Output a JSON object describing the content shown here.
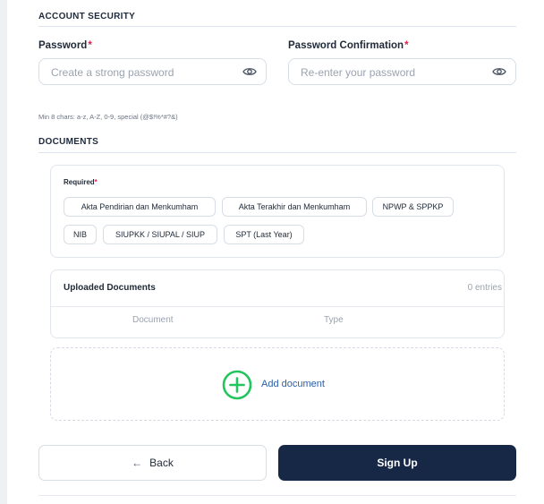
{
  "account_security": {
    "title": "ACCOUNT SECURITY",
    "password": {
      "label": "Password",
      "required_mark": "*",
      "placeholder": "Create a strong password",
      "icon": "eye-icon"
    },
    "password_confirmation": {
      "label": "Password Confirmation",
      "required_mark": "*",
      "placeholder": "Re-enter your password",
      "icon": "eye-icon"
    },
    "hint": "Min 8 chars: a-z, A-Z, 0-9, special (@$!%*#?&)"
  },
  "documents": {
    "title": "DOCUMENTS",
    "required_label": "Required",
    "required_mark": "*",
    "required_docs": [
      "Akta Pendirian dan Menkumham",
      "Akta Terakhir dan Menkumham",
      "NPWP & SPPKP",
      "NIB",
      "SIUPKK / SIUPAL / SIUP",
      "SPT (Last Year)"
    ],
    "uploaded": {
      "title": "Uploaded Documents",
      "entries": "0 entries",
      "columns": [
        "Document",
        "Type"
      ]
    },
    "add_label": "Add document",
    "add_icon": "plus-circle-icon"
  },
  "actions": {
    "back_arrow": "←",
    "back_label": "Back",
    "signup_label": "Sign Up"
  },
  "colors": {
    "primary": "#172746",
    "required": "#e11d48",
    "add_icon": "#22c55e",
    "link": "#2b5ea7"
  }
}
